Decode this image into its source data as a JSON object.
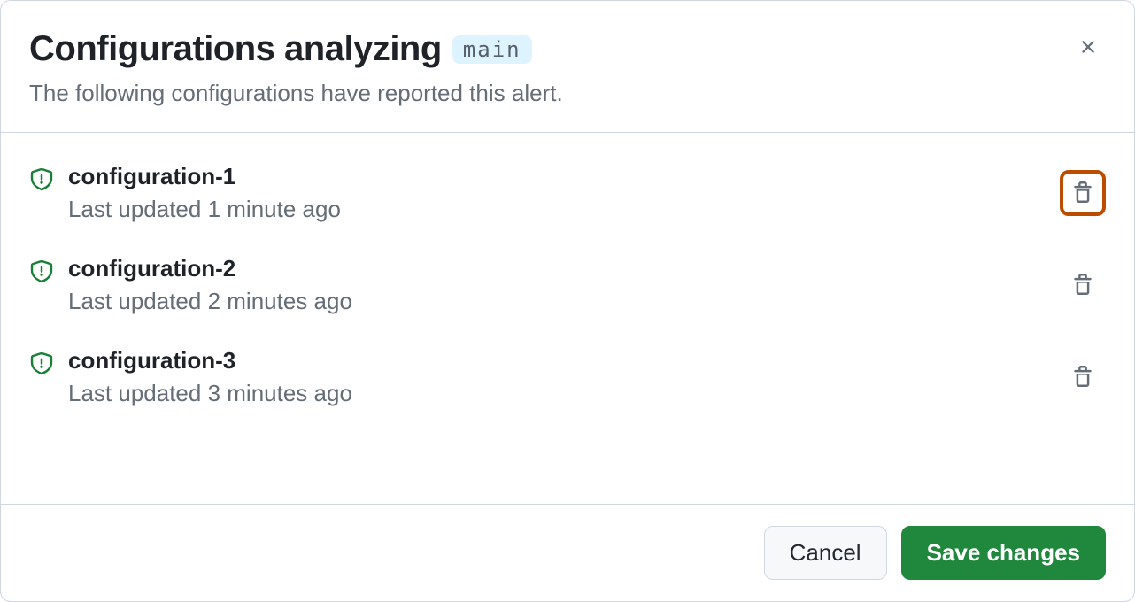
{
  "header": {
    "title": "Configurations analyzing",
    "branch": "main",
    "subtitle": "The following configurations have reported this alert."
  },
  "configurations": [
    {
      "name": "configuration-1",
      "updated": "Last updated 1 minute ago",
      "highlighted": true
    },
    {
      "name": "configuration-2",
      "updated": "Last updated 2 minutes ago",
      "highlighted": false
    },
    {
      "name": "configuration-3",
      "updated": "Last updated 3 minutes ago",
      "highlighted": false
    }
  ],
  "footer": {
    "cancel_label": "Cancel",
    "save_label": "Save changes"
  },
  "colors": {
    "accent_green": "#1a7f37",
    "highlight_orange": "#bc4c00",
    "primary_button": "#1f883d"
  }
}
